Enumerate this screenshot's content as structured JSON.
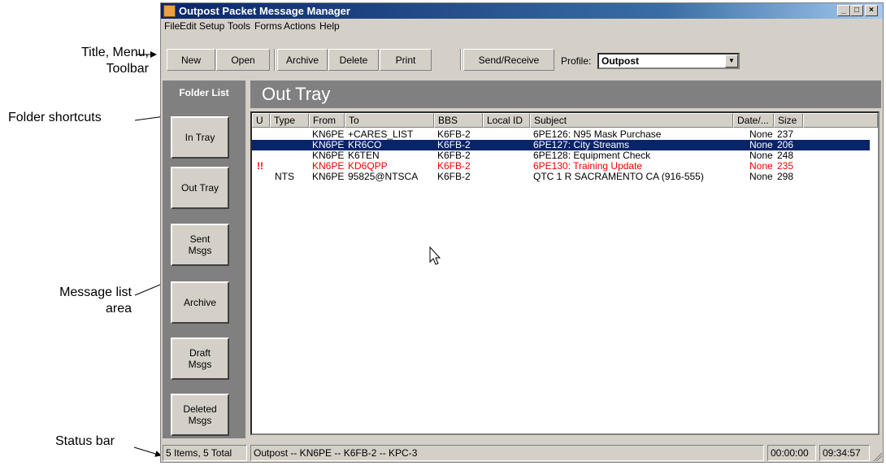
{
  "annotations": {
    "title_menu_toolbar_line1": "Title, Menu,",
    "title_menu_toolbar_line2": "Toolbar",
    "folder_shortcuts": "Folder shortcuts",
    "message_list_line1": "Message list",
    "message_list_line2": "area",
    "status_bar": "Status bar"
  },
  "window": {
    "title": "Outpost Packet Message Manager",
    "controls": {
      "minimize": "_",
      "maximize": "□",
      "close": "×"
    }
  },
  "menu": [
    "File",
    "Edit",
    "Setup",
    "Tools",
    "Forms",
    "Actions",
    "Help"
  ],
  "toolbar": {
    "new": "New",
    "open": "Open",
    "archive": "Archive",
    "delete": "Delete",
    "print": "Print",
    "send_receive": "Send/Receive",
    "profile_label": "Profile:",
    "profile_value": "Outpost"
  },
  "folders": {
    "header": "Folder List",
    "in_tray": "In Tray",
    "out_tray": "Out Tray",
    "sent": "Sent\nMsgs",
    "archive": "Archive",
    "draft": "Draft\nMsgs",
    "deleted": "Deleted\nMsgs"
  },
  "tray_title": "Out Tray",
  "columns": {
    "u": "U",
    "type": "Type",
    "from": "From",
    "to": "To",
    "bbs": "BBS",
    "local_id": "Local ID",
    "subject": "Subject",
    "date": "Date/...",
    "size": "Size"
  },
  "messages": [
    {
      "u": "",
      "type": "",
      "from": "KN6PE",
      "to": "+CARES_LIST",
      "bbs": "K6FB-2",
      "local_id": "",
      "subject": "6PE126: N95 Mask Purchase",
      "date": "None",
      "size": "237"
    },
    {
      "u": "",
      "type": "",
      "from": "KN6PE",
      "to": "KR6CO",
      "bbs": "K6FB-2",
      "local_id": "",
      "subject": "6PE127: City Streams",
      "date": "None",
      "size": "206"
    },
    {
      "u": "",
      "type": "",
      "from": "KN6PE",
      "to": "K6TEN",
      "bbs": "K6FB-2",
      "local_id": "",
      "subject": "6PE128: Equipment Check",
      "date": "None",
      "size": "248"
    },
    {
      "u": "!!",
      "type": "",
      "from": "KN6PE",
      "to": "KD6QPP",
      "bbs": "K6FB-2",
      "local_id": "",
      "subject": "6PE130: Training Update",
      "date": "None",
      "size": "235"
    },
    {
      "u": "",
      "type": "NTS",
      "from": "KN6PE",
      "to": "95825@NTSCA",
      "bbs": "K6FB-2",
      "local_id": "",
      "subject": "QTC 1 R SACRAMENTO CA (916-555)",
      "date": "None",
      "size": "298"
    }
  ],
  "status": {
    "count": "5 Items, 5 Total",
    "connection": "Outpost -- KN6PE -- K6FB-2 -- KPC-3",
    "timer": "00:00:00",
    "clock": "09:34:57"
  },
  "colors": {
    "title_bar": "#0a246a",
    "selection": "#0a246a",
    "urgent_text": "#f00000",
    "panel_gray": "#808080",
    "window_face": "#d4d0c8"
  }
}
